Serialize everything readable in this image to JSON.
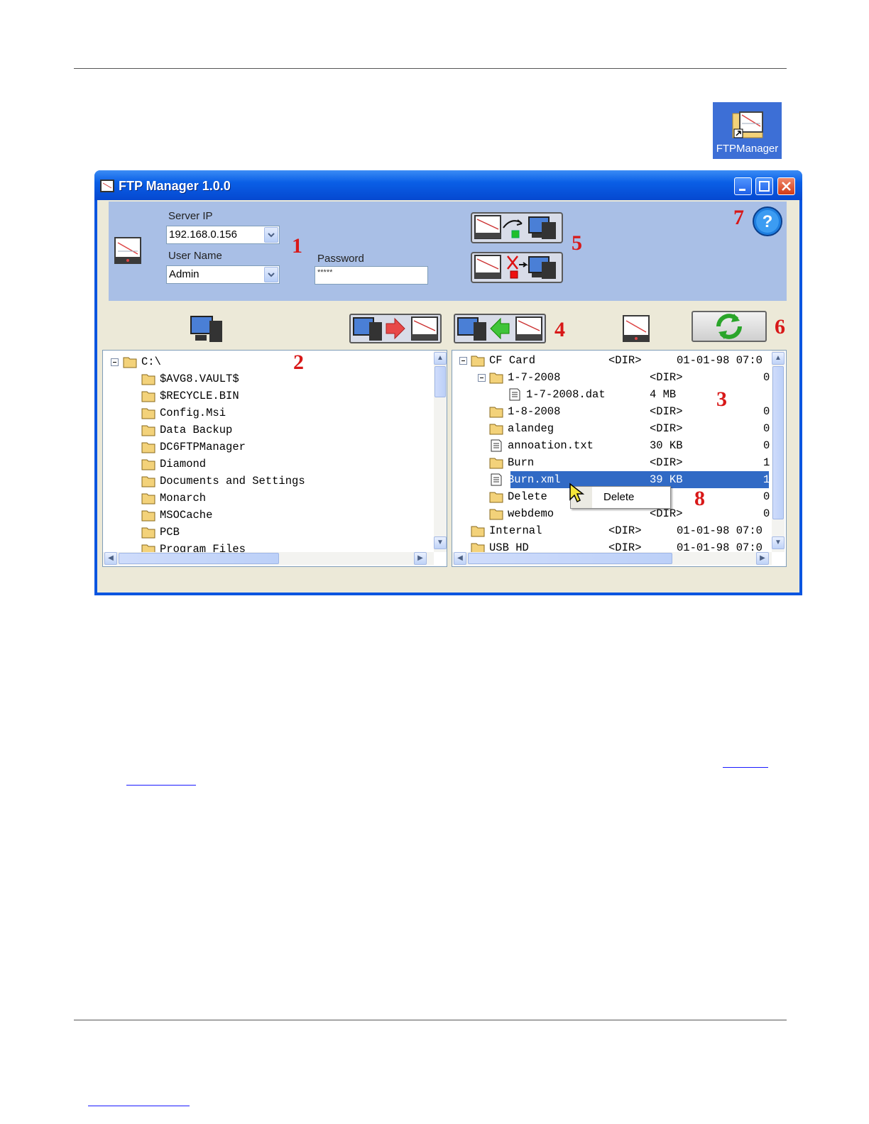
{
  "desktop_shortcut": {
    "label": "FTPManager"
  },
  "window": {
    "title": "FTP Manager 1.0.0"
  },
  "connection": {
    "server_ip_label": "Server IP",
    "server_ip_value": "192.168.0.156",
    "user_name_label": "User Name",
    "user_name_value": "Admin",
    "password_label": "Password",
    "password_value": "*****"
  },
  "callouts": [
    "1",
    "2",
    "3",
    "4",
    "5",
    "6",
    "7",
    "8"
  ],
  "local_tree": {
    "root": "C:\\",
    "items": [
      "$AVG8.VAULT$",
      "$RECYCLE.BIN",
      "Config.Msi",
      "Data Backup",
      "DC6FTPManager",
      "Diamond",
      "Documents and Settings",
      "Monarch",
      "MSOCache",
      "PCB",
      "Program Files"
    ]
  },
  "remote_tree": {
    "rows": [
      {
        "name": "CF Card",
        "size": "<DIR>",
        "date": "01-01-98 07:0"
      },
      {
        "name": "1-7-2008",
        "size": "<DIR>",
        "extra": "0"
      },
      {
        "name": "1-7-2008.dat",
        "size": "4 MB"
      },
      {
        "name": "1-8-2008",
        "size": "<DIR>",
        "extra": "0"
      },
      {
        "name": "alandeg",
        "size": "<DIR>",
        "extra": "0"
      },
      {
        "name": "annoation.txt",
        "size": "30 KB",
        "extra": "0"
      },
      {
        "name": "Burn",
        "size": "<DIR>",
        "extra": "1"
      },
      {
        "name": "Burn.xml",
        "size": "39 KB",
        "extra": "1"
      },
      {
        "name": "Delete",
        "size": "R>",
        "extra": "0"
      },
      {
        "name": "webdemo",
        "size": "<DIR>",
        "extra": "0"
      },
      {
        "name": "Internal",
        "size": "<DIR>",
        "date": "01-01-98 07:0"
      },
      {
        "name": "USB HD",
        "size": "<DIR>",
        "date": "01-01-98 07:0"
      }
    ]
  },
  "context_menu": {
    "item": "Delete"
  },
  "colors": {
    "title_bar": "#0a5fe6",
    "header_panel": "#a9bfe6",
    "callout_red": "#d81818",
    "selection": "#316ac5"
  }
}
